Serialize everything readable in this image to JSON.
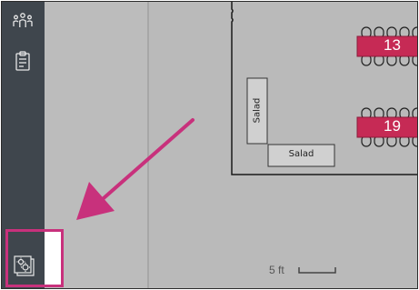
{
  "sidebar": {
    "icons": [
      "people-icon",
      "clipboard-icon",
      "floorplan-settings-icon"
    ]
  },
  "floorplan": {
    "tables": [
      {
        "number": "13"
      },
      {
        "number": "19"
      }
    ],
    "stations": [
      {
        "label": "Salad"
      },
      {
        "label": "Salad"
      }
    ],
    "scale": {
      "label": "5 ft"
    }
  },
  "colors": {
    "sidebar": "#3f464d",
    "table": "#c62a55",
    "annotation": "#c8317c"
  }
}
